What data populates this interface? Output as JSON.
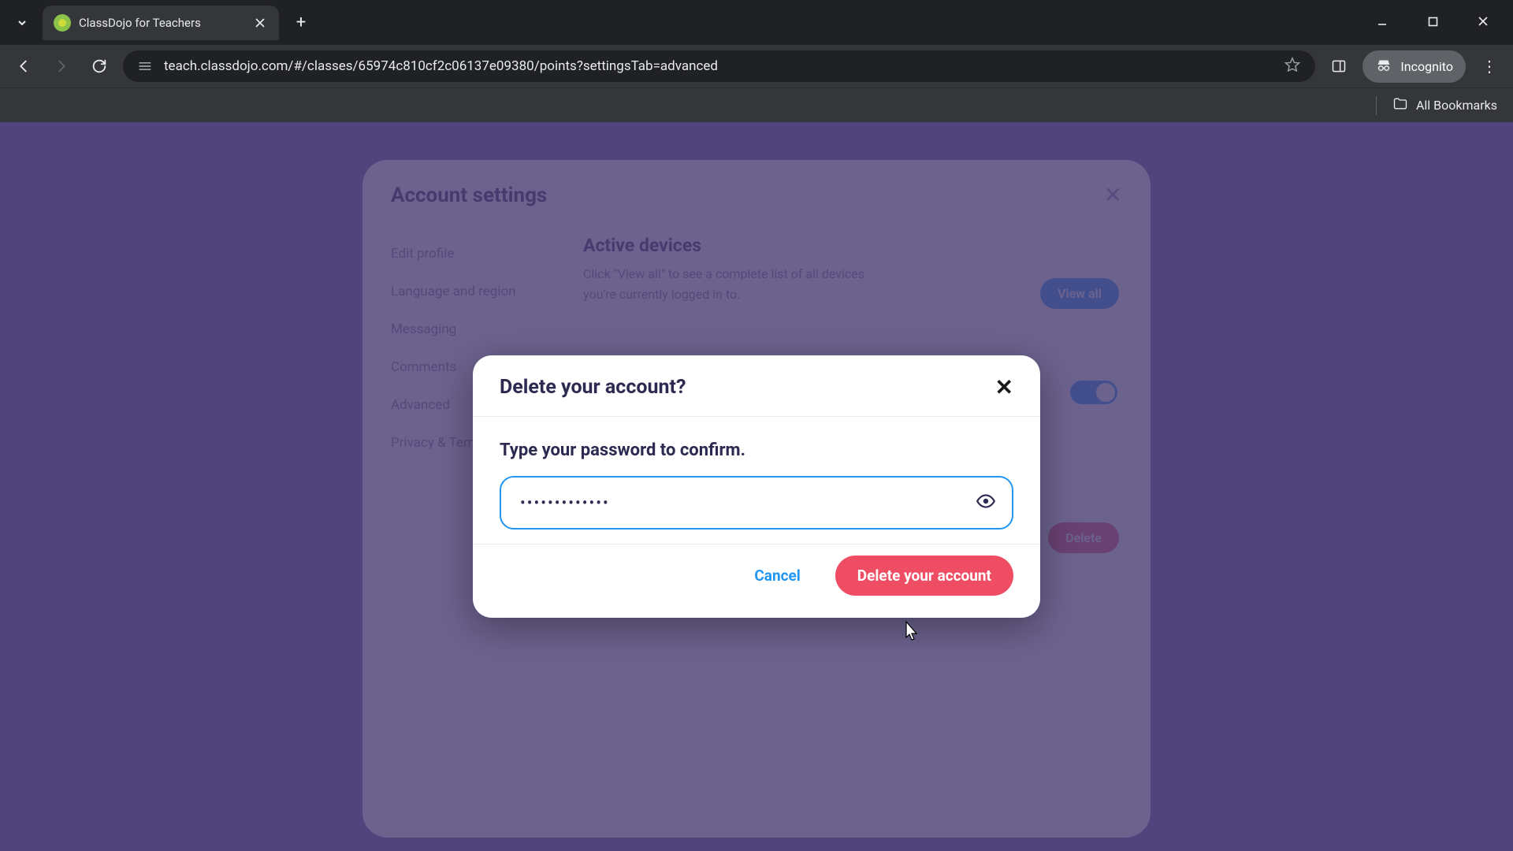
{
  "browser": {
    "tab_title": "ClassDojo for Teachers",
    "url": "teach.classdojo.com/#/classes/65974c810cf2c06137e09380/points?settingsTab=advanced",
    "incognito_label": "Incognito",
    "all_bookmarks": "All Bookmarks"
  },
  "settings_panel": {
    "title": "Account settings",
    "nav": {
      "edit_profile": "Edit profile",
      "language": "Language and region",
      "messaging": "Messaging",
      "comments": "Comments",
      "advanced": "Advanced",
      "privacy": "Privacy & Terms"
    },
    "active_devices": {
      "title": "Active devices",
      "desc": "Click \"View all\" to see a complete list of all devices you're currently logged in to.",
      "view_all": "View all"
    },
    "delete_label": "Delete"
  },
  "modal": {
    "title": "Delete your account?",
    "confirm_label": "Type your password to confirm.",
    "password_value": "•••••••••••••",
    "cancel": "Cancel",
    "delete": "Delete your account"
  }
}
